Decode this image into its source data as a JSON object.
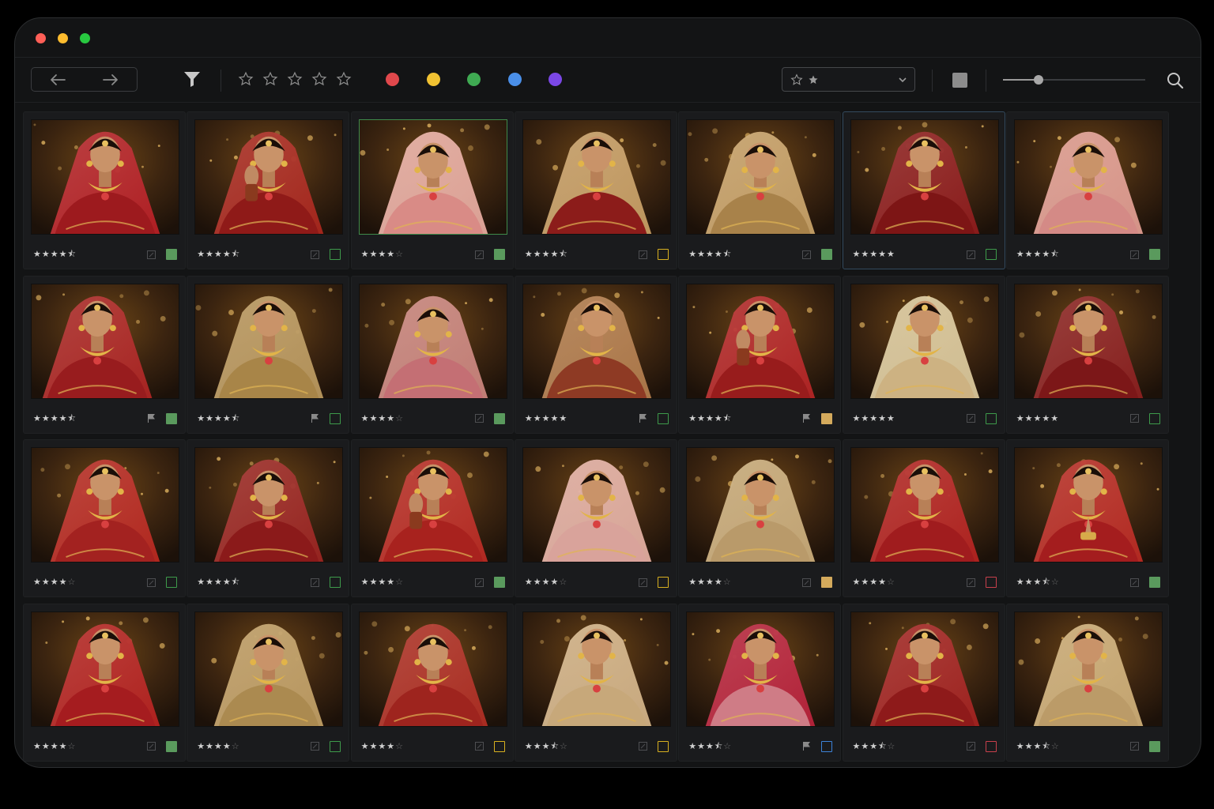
{
  "window": {
    "traffic_lights": [
      {
        "name": "close",
        "color": "#ff5f57"
      },
      {
        "name": "minimize",
        "color": "#febc2e"
      },
      {
        "name": "zoom",
        "color": "#28c840"
      }
    ]
  },
  "toolbar": {
    "back_icon": "arrow-left-icon",
    "forward_icon": "arrow-right-icon",
    "filter_icon": "filter-funnel-icon",
    "rating_filter_stars": 5,
    "color_labels": [
      {
        "name": "red",
        "color": "#e0484c"
      },
      {
        "name": "yellow",
        "color": "#f1c232"
      },
      {
        "name": "green",
        "color": "#3faa52"
      },
      {
        "name": "blue",
        "color": "#4a8fe8"
      },
      {
        "name": "purple",
        "color": "#7b47e6"
      }
    ],
    "sort_select_icons": [
      "star-outline-icon",
      "star-filled-icon",
      "chevron-down-icon"
    ],
    "view_toggle_icon": "square-icon",
    "thumbnail_size_percent": 25,
    "search_icon": "search-icon"
  },
  "grid": {
    "columns": 7,
    "rows": 4,
    "photos": [
      {
        "rating": 4.5,
        "flag": "edit",
        "label": "green",
        "label_filled": true,
        "pose": "smile",
        "dress": "#9d1a1e",
        "veil": "#b51f24"
      },
      {
        "rating": 4.5,
        "flag": "edit",
        "label": "green",
        "label_filled": false,
        "pose": "hand",
        "dress": "#8f1a18",
        "veil": "#a8261c"
      },
      {
        "rating": 4,
        "flag": "edit",
        "label": "green",
        "label_filled": true,
        "pose": "down",
        "dress": "#d98b86",
        "veil": "#e4a89c",
        "active": true
      },
      {
        "rating": 4.5,
        "flag": "edit",
        "label": "yellow",
        "label_filled": false,
        "pose": "smile",
        "dress": "#8c1c1a",
        "veil": "#c59c62"
      },
      {
        "rating": 4.5,
        "flag": "edit",
        "label": "green",
        "label_filled": true,
        "pose": "down",
        "dress": "#a8824a",
        "veil": "#c6a066"
      },
      {
        "rating": 5,
        "flag": "edit",
        "label": "green",
        "label_filled": false,
        "pose": "smile",
        "dress": "#7d1515",
        "veil": "#8d1b1b",
        "selected": true
      },
      {
        "rating": 4.5,
        "flag": "edit",
        "label": "green",
        "label_filled": true,
        "pose": "down",
        "dress": "#d48a86",
        "veil": "#de9a8e"
      },
      {
        "rating": 4.5,
        "flag": "flag",
        "label": "green",
        "label_filled": true,
        "pose": "side",
        "dress": "#981c1e",
        "veil": "#ac2422"
      },
      {
        "rating": 4.5,
        "flag": "flag",
        "label": "green",
        "label_filled": false,
        "pose": "smile",
        "dress": "#a88548",
        "veil": "#b8965c"
      },
      {
        "rating": 4,
        "flag": "edit",
        "label": "green",
        "label_filled": true,
        "pose": "down",
        "dress": "#c46f74",
        "veil": "#c8827a"
      },
      {
        "rating": 5,
        "flag": "flag",
        "label": "green",
        "label_filled": false,
        "pose": "smile",
        "dress": "#8e3a24",
        "veil": "#b07a4a"
      },
      {
        "rating": 4.5,
        "flag": "flag",
        "label": "yellow",
        "label_filled": true,
        "pose": "hand",
        "dress": "#981c1c",
        "veil": "#b32424"
      },
      {
        "rating": 5,
        "flag": "edit",
        "label": "green",
        "label_filled": false,
        "pose": "smile",
        "dress": "#cdb282",
        "veil": "#d8c598"
      },
      {
        "rating": 5,
        "flag": "edit",
        "label": "green",
        "label_filled": false,
        "pose": "smile",
        "dress": "#7c1718",
        "veil": "#8a1f1e"
      },
      {
        "rating": 4,
        "flag": "edit",
        "label": "green",
        "label_filled": false,
        "pose": "smile",
        "dress": "#a32220",
        "veil": "#b7281f"
      },
      {
        "rating": 4.5,
        "flag": "edit",
        "label": "green",
        "label_filled": false,
        "pose": "down",
        "dress": "#8b1a1a",
        "veil": "#9a2420"
      },
      {
        "rating": 4,
        "flag": "edit",
        "label": "green",
        "label_filled": true,
        "pose": "hand",
        "dress": "#a8221e",
        "veil": "#b82a22"
      },
      {
        "rating": 4,
        "flag": "edit",
        "label": "yellow",
        "label_filled": false,
        "pose": "down",
        "dress": "#d9a39b",
        "veil": "#e0ac9e"
      },
      {
        "rating": 4,
        "flag": "edit",
        "label": "yellow",
        "label_filled": true,
        "pose": "down",
        "dress": "#b99a6a",
        "veil": "#c8aa78"
      },
      {
        "rating": 4,
        "flag": "edit",
        "label": "red",
        "label_filled": false,
        "pose": "smile",
        "dress": "#a01c1e",
        "veil": "#b3221f"
      },
      {
        "rating": 3.5,
        "flag": "edit",
        "label": "green",
        "label_filled": true,
        "pose": "namaste",
        "dress": "#a41d1e",
        "veil": "#b82a22"
      },
      {
        "rating": 4,
        "flag": "edit",
        "label": "green",
        "label_filled": true,
        "pose": "smile",
        "dress": "#a51c1f",
        "veil": "#b5221f"
      },
      {
        "rating": 4,
        "flag": "edit",
        "label": "green",
        "label_filled": false,
        "pose": "down",
        "dress": "#ab8a50",
        "veil": "#be9c62"
      },
      {
        "rating": 4,
        "flag": "edit",
        "label": "yellow",
        "label_filled": false,
        "pose": "down",
        "dress": "#9e241e",
        "veil": "#ae2d22"
      },
      {
        "rating": 3.5,
        "flag": "edit",
        "label": "yellow",
        "label_filled": false,
        "pose": "smile",
        "dress": "#c7a87a",
        "veil": "#d0b084"
      },
      {
        "rating": 3.5,
        "flag": "flag",
        "label": "blue",
        "label_filled": false,
        "pose": "smile",
        "dress": "#cf7c86",
        "veil": "#b8223a"
      },
      {
        "rating": 3.5,
        "flag": "edit",
        "label": "red",
        "label_filled": false,
        "pose": "smile",
        "dress": "#8e1a1a",
        "veil": "#a2221f"
      },
      {
        "rating": 3.5,
        "flag": "edit",
        "label": "green",
        "label_filled": true,
        "pose": "smile",
        "dress": "#bb9b68",
        "veil": "#cbab74"
      }
    ]
  },
  "label_colors": {
    "green": "#3e9b4b",
    "yellow": "#d8b020",
    "red": "#c8404c",
    "blue": "#3d82d8",
    "green_filled": "#5a9a5d",
    "yellow_filled": "#d4aa5c",
    "red_filled": "#b04050"
  }
}
